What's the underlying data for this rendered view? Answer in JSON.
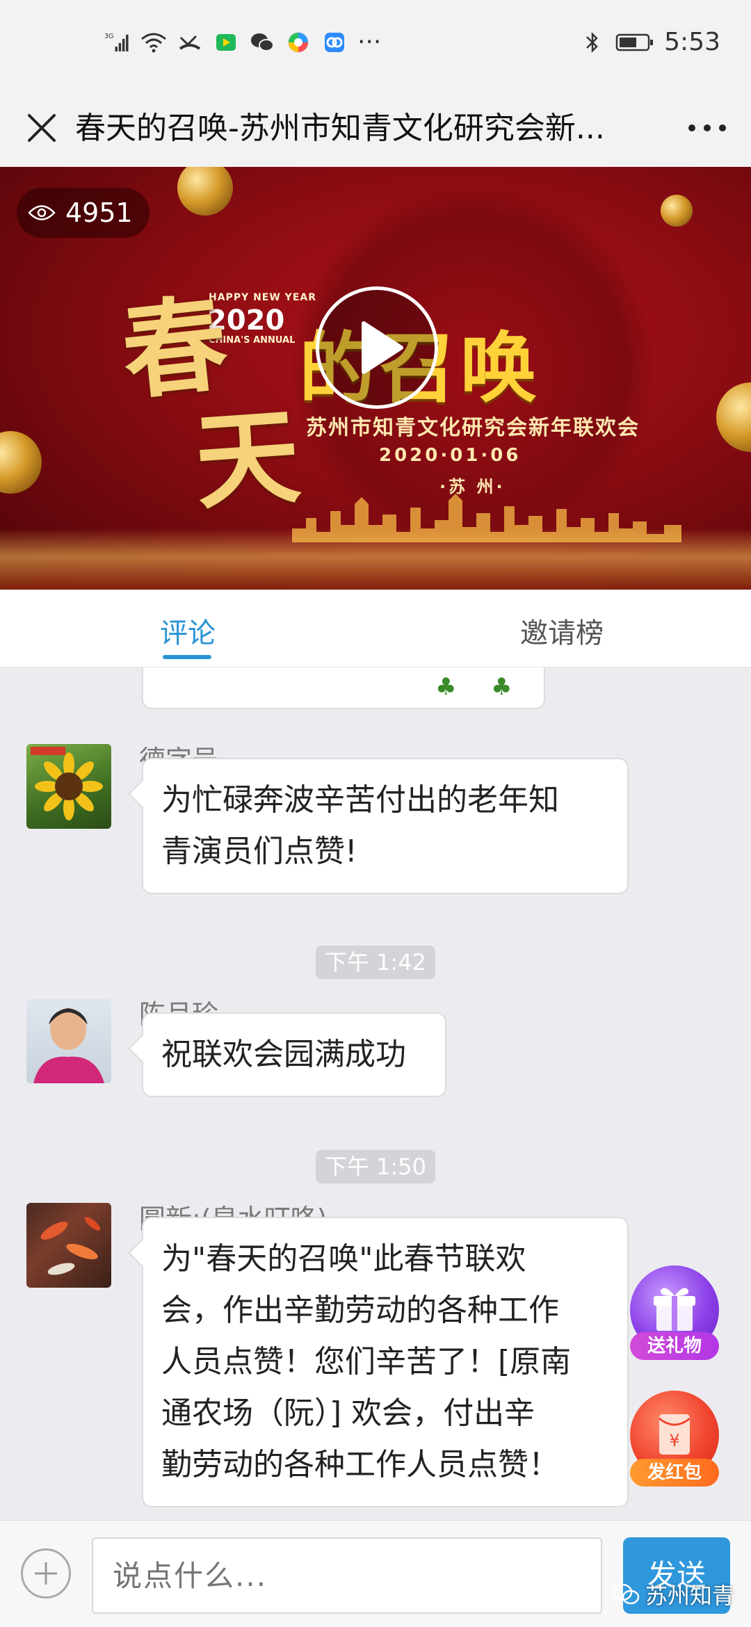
{
  "status_bar": {
    "network": "3G",
    "time": "5:53",
    "more": "···"
  },
  "nav": {
    "title": "春天的召唤-苏州市知青文化研究会新..."
  },
  "video": {
    "views": "4951",
    "poster_happy": "HAPPY NEW YEAR",
    "poster_year": "2020",
    "poster_annual": "CHINA'S ANNUAL",
    "poster_chun": "春",
    "poster_tian": "天",
    "poster_title": "的召唤",
    "poster_subtitle": "苏州市知青文化研究会新年联欢会",
    "poster_date": "2020·01·06",
    "poster_place": "·苏 州·"
  },
  "tabs": [
    {
      "label": "评论",
      "active": true
    },
    {
      "label": "邀请榜",
      "active": false
    }
  ],
  "comments": [
    {
      "name": "德字号",
      "text_lines": [
        "为忙碌奔波辛苦付出的老年知",
        "青演员们点赞!"
      ]
    },
    {
      "time": "下午 1:42"
    },
    {
      "name": "陈月珍",
      "text_lines": [
        "祝联欢会园满成功"
      ]
    },
    {
      "time": "下午 1:50"
    },
    {
      "name": "圆新:(泉水叮咚)",
      "text_lines": [
        "为\"春天的召唤\"此春节联欢",
        "会，作出辛勤劳动的各种工作",
        "人员点赞！您们辛苦了！[原南",
        "通农场（阮）] 欢会，付出辛",
        "勤劳动的各种工作人员点赞！"
      ]
    }
  ],
  "fabs": {
    "gift_label": "送礼物",
    "redpacket_label": "发红包",
    "redpacket_symbol": "¥"
  },
  "input": {
    "placeholder": "说点什么...",
    "send_label": "发送"
  },
  "watermark": {
    "text": "苏州知青"
  },
  "colors": {
    "accent": "#2a93d5",
    "send_button": "#2f97dc",
    "gift": "#8c3fe8",
    "redpacket": "#f0452f"
  }
}
